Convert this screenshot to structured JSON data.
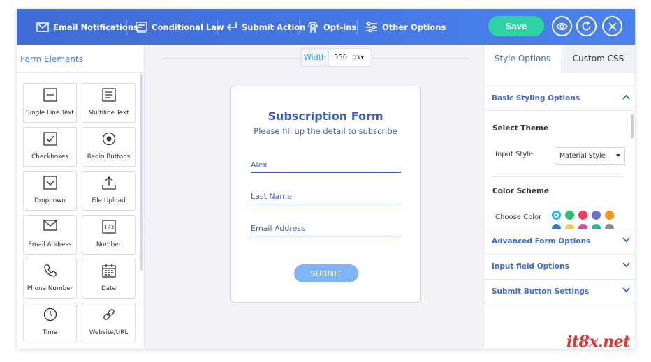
{
  "topbar": {
    "nav": [
      {
        "label": "Email Notifications",
        "icon": "envelope-icon"
      },
      {
        "label": "Conditional Law",
        "icon": "conditional-icon"
      },
      {
        "label": "Submit Action",
        "icon": "submit-arrow-icon"
      },
      {
        "label": "Opt-ins",
        "icon": "opt-in-icon"
      },
      {
        "label": "Other Options",
        "icon": "sliders-icon"
      }
    ],
    "save_label": "Save",
    "buttons": [
      "eye-icon",
      "refresh-icon",
      "close-icon"
    ],
    "accent": "#4b82ee",
    "save_color": "#2ed3a4"
  },
  "left_panel": {
    "title": "Form Elements",
    "elements": [
      {
        "label": "Single Line Text",
        "icon": "single-line-text-icon"
      },
      {
        "label": "Multiline Text",
        "icon": "multiline-text-icon"
      },
      {
        "label": "Checkboxes",
        "icon": "checkbox-icon"
      },
      {
        "label": "Radio Buttons",
        "icon": "radio-icon"
      },
      {
        "label": "Dropdown",
        "icon": "dropdown-icon"
      },
      {
        "label": "File Upload",
        "icon": "upload-icon"
      },
      {
        "label": "Email Address",
        "icon": "envelope-icon"
      },
      {
        "label": "Number",
        "icon": "number-icon"
      },
      {
        "label": "Phone Number",
        "icon": "phone-icon"
      },
      {
        "label": "Date",
        "icon": "calendar-icon"
      },
      {
        "label": "Time",
        "icon": "clock-icon"
      },
      {
        "label": "Website/URL",
        "icon": "link-icon"
      }
    ]
  },
  "canvas": {
    "width_label": "Width",
    "width_value": "550",
    "width_unit": "px",
    "form": {
      "title": "Subscription Form",
      "subtitle": "Please fill up the detail to subscribe",
      "fields": [
        {
          "value": "Alex",
          "active": true
        },
        {
          "value": "Last Name",
          "active": false
        },
        {
          "value": "Email Address",
          "active": false
        }
      ],
      "submit_label": "SUBMIT"
    }
  },
  "right_panel": {
    "tabs": [
      "Style Options",
      "Custom CSS"
    ],
    "sections": [
      {
        "label": "Basic Styling Options",
        "expanded": true
      },
      {
        "label": "Advanced Form Options",
        "expanded": false
      },
      {
        "label": "Input field Options",
        "expanded": false
      },
      {
        "label": "Submit Button Settings",
        "expanded": false
      }
    ],
    "select_theme_title": "Select Theme",
    "input_style_label": "Input Style",
    "input_style_value": "Material Style",
    "color_scheme_title": "Color Scheme",
    "choose_color_label": "Choose Color",
    "colors": [
      "#2ab5e8",
      "#2ec26a",
      "#ef3d5a",
      "#6d6fd6",
      "#f7941d"
    ],
    "colors_row2": [
      "#2f7ad0",
      "#f7c948",
      "#e84393",
      "#1abc9c",
      "#888888"
    ]
  },
  "watermark": "it8x.net"
}
